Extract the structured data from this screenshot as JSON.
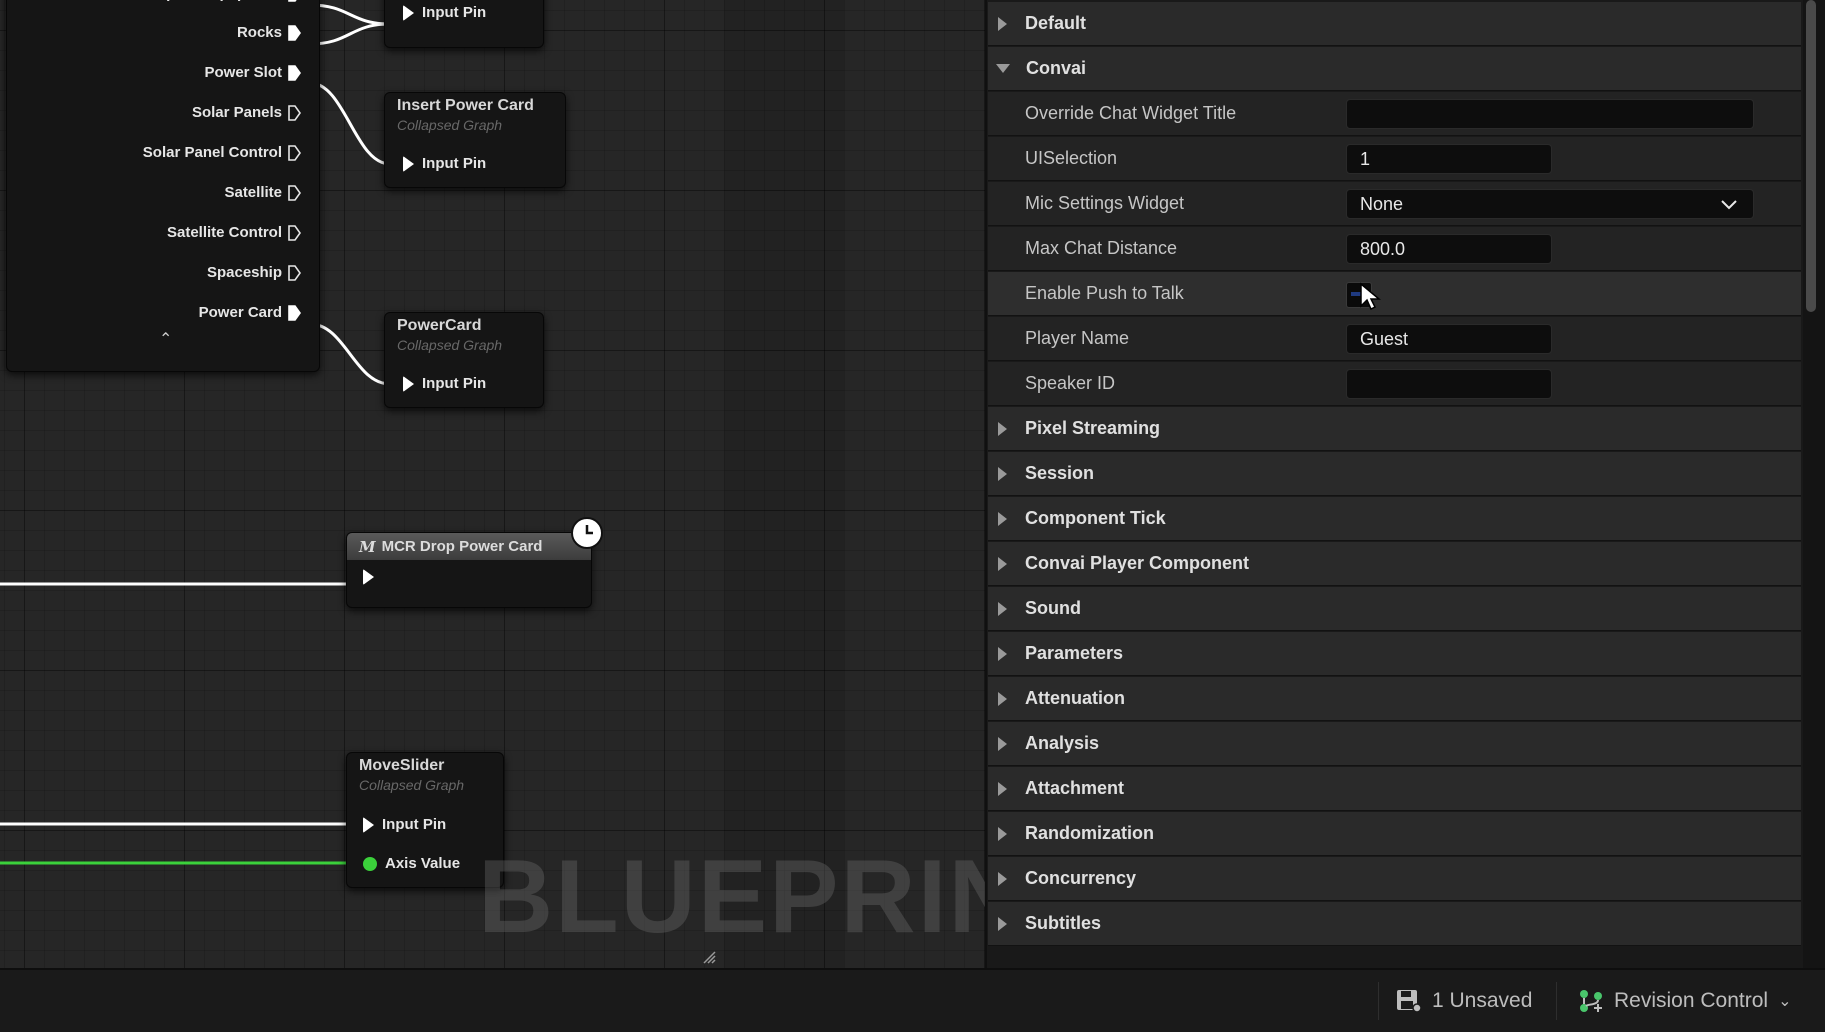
{
  "graph": {
    "sequence_outputs": [
      {
        "label": "Space Equipment",
        "connected": true
      },
      {
        "label": "Rocks",
        "connected": true
      },
      {
        "label": "Power Slot",
        "connected": true
      },
      {
        "label": "Solar Panels",
        "connected": false
      },
      {
        "label": "Solar Panel Control",
        "connected": false
      },
      {
        "label": "Satellite",
        "connected": false
      },
      {
        "label": "Satellite Control",
        "connected": false
      },
      {
        "label": "Spaceship",
        "connected": false
      },
      {
        "label": "Power Card",
        "connected": true
      }
    ],
    "nodes": {
      "top_graph": {
        "pin": "Input Pin"
      },
      "insert_power_card": {
        "title": "Insert Power Card",
        "subtitle": "Collapsed Graph",
        "pin": "Input Pin"
      },
      "power_card": {
        "title": "PowerCard",
        "subtitle": "Collapsed Graph",
        "pin": "Input Pin"
      },
      "macro": {
        "icon": "M",
        "title": "MCR Drop Power Card"
      },
      "move_slider": {
        "title": "MoveSlider",
        "subtitle": "Collapsed Graph",
        "pins": [
          "Input Pin",
          "Axis Value"
        ]
      }
    },
    "watermark": "BLUEPRINT",
    "wire_colors": {
      "exec": "#ffffff",
      "float": "#3bd13b"
    }
  },
  "details": {
    "categories_top": [
      {
        "label": "Default",
        "expanded": false
      },
      {
        "label": "Convai",
        "expanded": true
      }
    ],
    "properties": [
      {
        "name": "Override Chat Widget Title",
        "value": "",
        "kind": "text-wide"
      },
      {
        "name": "UISelection",
        "value": "1",
        "kind": "text-narrow"
      },
      {
        "name": "Mic Settings Widget",
        "value": "None",
        "kind": "dropdown"
      },
      {
        "name": "Max Chat Distance",
        "value": "800.0",
        "kind": "text-narrow"
      },
      {
        "name": "Enable Push to Talk",
        "value": "",
        "kind": "checkbox"
      },
      {
        "name": "Player Name",
        "value": "Guest",
        "kind": "text-narrow"
      },
      {
        "name": "Speaker ID",
        "value": "",
        "kind": "text-narrow"
      }
    ],
    "categories_bottom": [
      "Pixel Streaming",
      "Session",
      "Component Tick",
      "Convai Player Component",
      "Sound",
      "Parameters",
      "Attenuation",
      "Analysis",
      "Attachment",
      "Randomization",
      "Concurrency",
      "Subtitles"
    ]
  },
  "statusbar": {
    "unsaved": "1 Unsaved",
    "revision_control": "Revision Control",
    "unsaved_icon": "save-icon",
    "revision_icon": "revision-control-icon"
  }
}
